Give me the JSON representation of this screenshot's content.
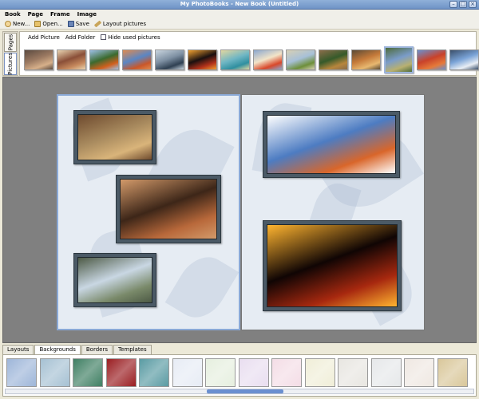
{
  "window": {
    "title": "My PhotoBooks - New Book (Untitled)"
  },
  "menu": [
    "Book",
    "Page",
    "Frame",
    "Image"
  ],
  "toolbar": [
    {
      "label": "New...",
      "icon": "new-icon"
    },
    {
      "label": "Open...",
      "icon": "open-folder-icon"
    },
    {
      "label": "Save",
      "icon": "save-disk-icon"
    },
    {
      "label": "Layout pictures",
      "icon": "magic-wand-icon"
    }
  ],
  "side_tabs": {
    "pages": "Pages",
    "pictures": "Pictures"
  },
  "pictures_panel": {
    "add_picture": "Add Picture",
    "add_folder": "Add Folder",
    "hide_used": "Hide used pictures",
    "thumbnails": [
      {
        "colors": [
          "#9c7a62",
          "#d7b08a",
          "#5b4a3f"
        ]
      },
      {
        "colors": [
          "#8a4f38",
          "#c78a5e",
          "#e9d3b0"
        ]
      },
      {
        "colors": [
          "#3b6a2f",
          "#d2601e",
          "#9cc0e6"
        ]
      },
      {
        "colors": [
          "#5a86c4",
          "#c9572a",
          "#e08a4f"
        ]
      },
      {
        "colors": [
          "#7d8fa2",
          "#2f4052",
          "#c9d5df"
        ]
      },
      {
        "colors": [
          "#1a1010",
          "#b3321a",
          "#f0a030"
        ]
      },
      {
        "colors": [
          "#6fb6c4",
          "#2f8fa0",
          "#e2d7a0"
        ]
      },
      {
        "colors": [
          "#f2e4c8",
          "#d9482a",
          "#8aa7cf"
        ]
      },
      {
        "colors": [
          "#a7c0d8",
          "#6d8f3a",
          "#d7d0b5"
        ]
      },
      {
        "colors": [
          "#355a2a",
          "#b7863c",
          "#8a6d4a"
        ]
      },
      {
        "colors": [
          "#c57a3a",
          "#e8b870",
          "#5a4a35"
        ]
      },
      {
        "colors": [
          "#7a9cc9",
          "#b8b070",
          "#4d6b3b"
        ]
      },
      {
        "colors": [
          "#c9422a",
          "#e67a3a",
          "#6a8fcf"
        ]
      },
      {
        "colors": [
          "#7aa3d7",
          "#e9eef5",
          "#3a4f6a"
        ]
      }
    ],
    "selected_index": 11
  },
  "spread": {
    "left_page": [
      {
        "name": "photo-desert-sunset",
        "colors": [
          "#a88a5e",
          "#d9b47a",
          "#6e4a2e"
        ]
      },
      {
        "name": "photo-cliff-dwelling",
        "colors": [
          "#3d2618",
          "#b8683a",
          "#d39a6a"
        ]
      },
      {
        "name": "photo-canyon-waterfall",
        "colors": [
          "#c9d7e3",
          "#7a8a6a",
          "#4d5a45"
        ]
      }
    ],
    "right_page": [
      {
        "name": "photo-delicate-arch",
        "colors": [
          "#4d7cc2",
          "#d9662a",
          "#ffffff"
        ]
      },
      {
        "name": "photo-lava-flow",
        "colors": [
          "#100504",
          "#a7280f",
          "#ffb530"
        ]
      }
    ]
  },
  "bottom_tabs": [
    "Layouts",
    "Backgrounds",
    "Borders",
    "Templates"
  ],
  "active_bottom_tab": "Backgrounds",
  "backgrounds": [
    "#9eb6d9",
    "#a6c1d3",
    "#3f7f63",
    "#9a1e22",
    "#5a9ba3",
    "#e7ecf5",
    "#e6efdf",
    "#e9def0",
    "#f4dde6",
    "#f0eed8",
    "#e8e6e1",
    "#e6e8ea",
    "#efe8e2",
    "#d9c79a"
  ]
}
